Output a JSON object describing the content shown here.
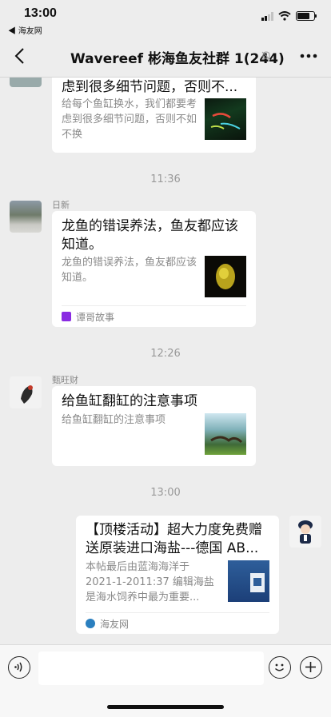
{
  "status_bar": {
    "time": "13:00",
    "back_app": "◀ 海友网",
    "battery_level": 0.75
  },
  "nav": {
    "title": "Wavereef 彬海鱼友社群 1(244)"
  },
  "messages": [
    {
      "title": "给每个鱼缸换水，我们都要考虑到很多细节问题，否则不...",
      "desc": "给每个鱼缸换水，我们都要考虑到很多细节问题，否则不如不换"
    },
    {
      "time": "11:36"
    },
    {
      "sender": "日新",
      "title": "龙鱼的错误养法，鱼友都应该知道。",
      "desc": "龙鱼的错误养法，鱼友都应该知道。",
      "source": "谭哥故事"
    },
    {
      "time": "12:26"
    },
    {
      "sender": "甄旺财",
      "title": "给鱼缸翻缸的注意事项",
      "desc": "给鱼缸翻缸的注意事项"
    },
    {
      "time": "13:00"
    },
    {
      "title": "【顶楼活动】超大力度免费赠送原装进口海盐---德国 AB...",
      "desc": "本帖最后由蓝海海洋于 2021-1-2011:37 编辑海盐是海水饲养中最为重要...",
      "source": "海友网"
    }
  ],
  "colors": {
    "background": "#ededed",
    "card": "#ffffff",
    "source_badge_1": "#8a2be2",
    "source_badge_2": "#2a7fbf"
  }
}
